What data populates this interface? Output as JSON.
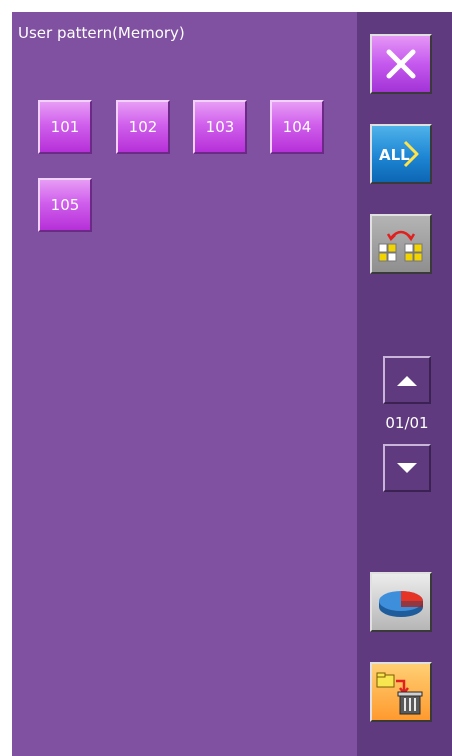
{
  "title": "User pattern(Memory)",
  "patterns": [
    "101",
    "102",
    "103",
    "104",
    "105"
  ],
  "sidebar": {
    "close_icon": "close-icon",
    "all_label": "ALL",
    "swap_icon": "swap-pattern-icon",
    "pie_icon": "pie-chart-icon",
    "delete_icon": "folder-to-trash-icon"
  },
  "pagination": {
    "page_text": "01/01",
    "up_icon": "triangle-up-icon",
    "down_icon": "triangle-down-icon"
  },
  "colors": {
    "main_bg": "#8051a0",
    "side_bg": "#5f3a7e",
    "pattern_button": "#d060ec",
    "close_button": "#c559ee",
    "all_button": "#1e86d4",
    "delete_button": "#ff9a2e"
  }
}
